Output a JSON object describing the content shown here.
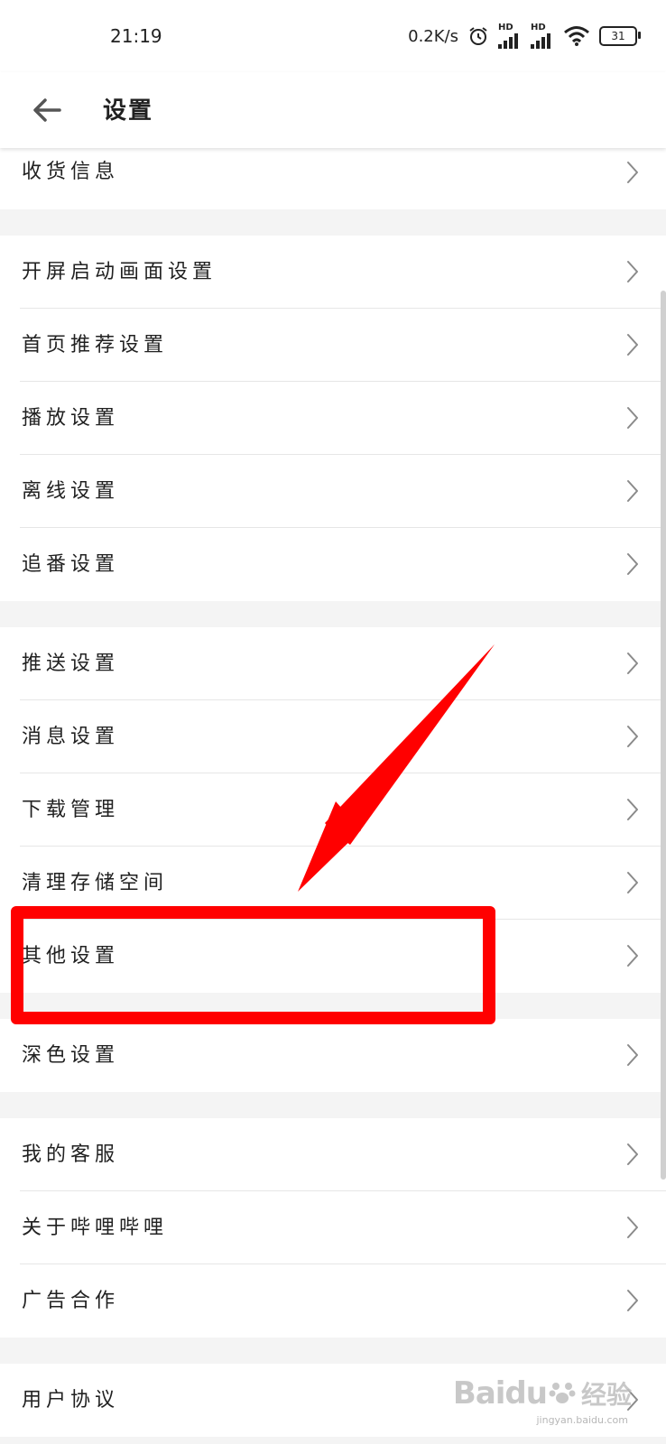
{
  "status_bar": {
    "time": "21:19",
    "net_speed": "0.2K/s",
    "sim1": "HD",
    "sim2": "HD",
    "battery": "31"
  },
  "app_bar": {
    "title": "设置"
  },
  "groups": [
    [
      "收货信息"
    ],
    [
      "开屏启动画面设置",
      "首页推荐设置",
      "播放设置",
      "离线设置",
      "追番设置"
    ],
    [
      "推送设置",
      "消息设置",
      "下载管理",
      "清理存储空间",
      "其他设置"
    ],
    [
      "深色设置"
    ],
    [
      "我的客服",
      "关于哔哩哔哩",
      "广告合作"
    ],
    [
      "用户协议"
    ]
  ],
  "watermark": {
    "brand": "Baidu",
    "cn": "经验",
    "url": "jingyan.baidu.com"
  },
  "annotation_color": "#ff0000"
}
